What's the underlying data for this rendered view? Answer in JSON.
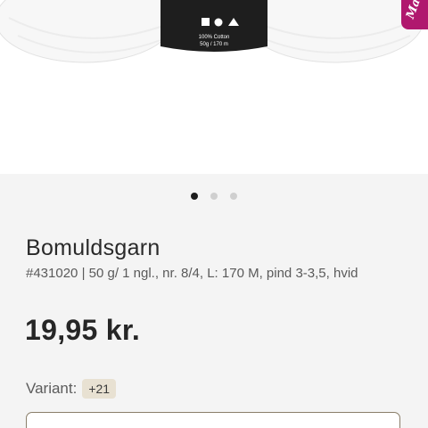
{
  "product_image": {
    "label_line1": "100% Cotton",
    "label_line2": "50g / 170 m",
    "brand_tab_text": "Ma"
  },
  "carousel": {
    "count": 3,
    "active_index": 0
  },
  "product": {
    "title": "Bomuldsgarn",
    "specs": "#431020  | 50 g/ 1 ngl., nr. 8/4, L: 170 M, pind 3-3,5, hvid",
    "price": "19,95 kr."
  },
  "variant": {
    "label": "Variant:",
    "count_badge": "+21"
  },
  "colors": {
    "brand": "#b0186e",
    "badge_bg": "#e8e1d2",
    "select_border": "#8a7f6a"
  }
}
